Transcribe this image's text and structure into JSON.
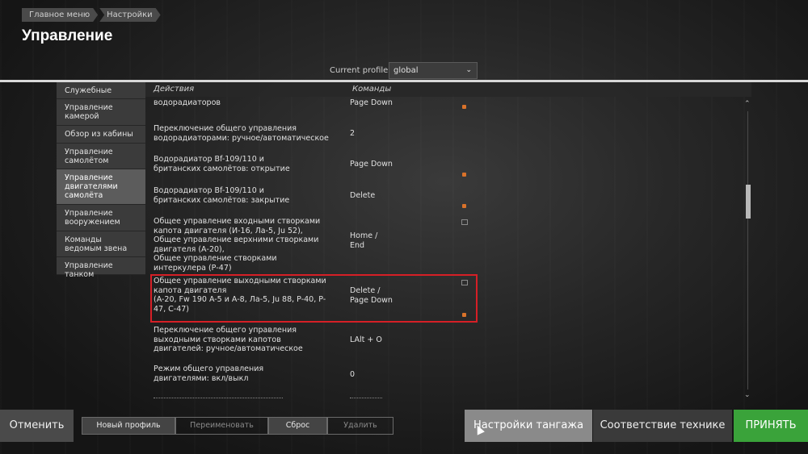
{
  "breadcrumb": [
    "Главное меню",
    "Настройки"
  ],
  "page_title": "Управление",
  "profile": {
    "label": "Current profile",
    "value": "global"
  },
  "sidebar": [
    "Служебные",
    "Управление камерой",
    "Обзор из кабины",
    "Управление самолётом",
    "Управление двигателями самолёта",
    "Управление вооружением",
    "Команды ведомым звена",
    "Управление танком"
  ],
  "table": {
    "col_action": "Действия",
    "col_commands": "Команды",
    "rows": [
      {
        "action": "Общее управление створками водорадиаторов",
        "cmd": "Delete /\nPage Down"
      },
      {
        "action": "Переключение общего управления водорадиаторами: ручное/автоматическое",
        "cmd": "2"
      },
      {
        "action": "Водорадиатор Bf-109/110 и британских самолётов: открытие",
        "cmd": "Page Down"
      },
      {
        "action": "Водорадиатор Bf-109/110 и британских самолётов: закрытие",
        "cmd": "Delete"
      },
      {
        "action": "Общее управление входными створками капота двигателя (И-16, Ла-5, Ju 52),\nОбщее управление верхними створками двигателя (А-20),\nОбщее управление створками интеркулера (Р-47)",
        "cmd": "Home /\nEnd"
      },
      {
        "action": "Общее управление выходными створками капота двигателя\n(A-20, Fw 190 A-5 и A-8, Ла-5, Ju 88, P-40, P-47, C-47)",
        "cmd": "Delete /\nPage Down"
      },
      {
        "action": "Переключение общего управления выходными створками капотов двигателей: ручное/автоматическое",
        "cmd": "LAlt + O"
      },
      {
        "action": "Режим общего управления двигателями: вкл/выкл",
        "cmd": "0"
      }
    ]
  },
  "buttons": {
    "cancel": "Отменить",
    "new_profile": "Новый профиль",
    "rename": "Переименовать",
    "reset": "Сброс",
    "delete": "Удалить",
    "tuning": "Настройки тангажа",
    "match": "Соответствие технике",
    "accept": "ПРИНЯТЬ"
  },
  "colors": {
    "accept": "#3aa33a",
    "highlight": "#d61f26",
    "bind_icon": "#d9722a"
  }
}
